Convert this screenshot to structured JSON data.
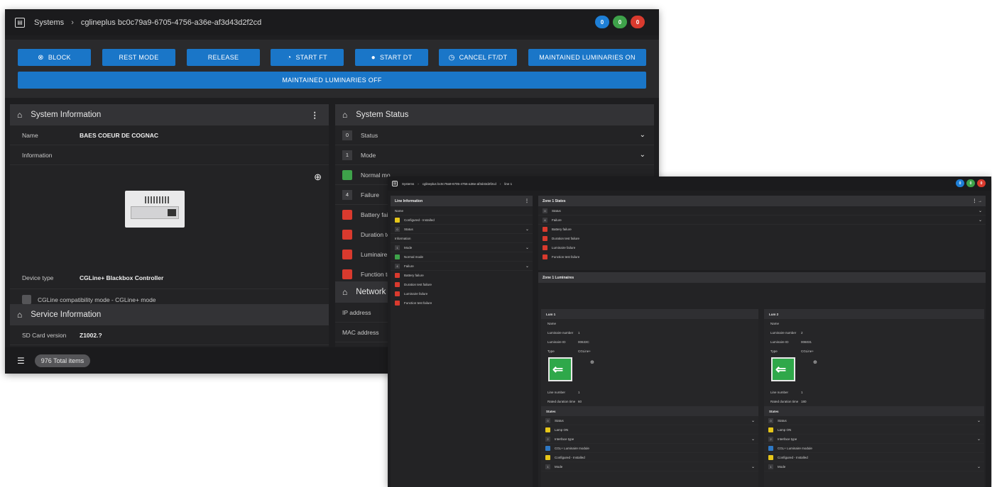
{
  "screen1": {
    "breadcrumb": {
      "root": "Systems",
      "current": "cglineplus bc0c79a9-6705-4756-a36e-af3d43d2f2cd"
    },
    "badges": [
      "0",
      "0",
      "0"
    ],
    "actions": {
      "block": "BLOCK",
      "rest_mode": "REST MODE",
      "release": "RELEASE",
      "start_ft": "START FT",
      "start_dt": "START DT",
      "cancel": "CANCEL FT/DT",
      "maint_on": "MAINTAINED LUMINARIES ON",
      "maint_off": "MAINTAINED LUMINARIES OFF"
    },
    "system_info": {
      "title": "System Information",
      "name_label": "Name",
      "name_value": "BAES COEUR DE COGNAC",
      "info_label": "Information",
      "device_label": "Device type",
      "device_value": "CGLine+ Blackbox Controller",
      "compat": "CGLine compatibility mode - CGLine+ mode"
    },
    "service_info": {
      "title": "Service Information",
      "sd_label": "SD Card version",
      "sd_value": "Z1002.?"
    },
    "system_status": {
      "title": "System Status",
      "rows": [
        {
          "num": "0",
          "label": "Status"
        },
        {
          "num": "1",
          "label": "Mode"
        },
        {
          "label": "Normal mo"
        },
        {
          "num": "4",
          "label": "Failure"
        },
        {
          "label": "Battery fai"
        },
        {
          "label": "Duration te"
        },
        {
          "label": "Luminaire"
        },
        {
          "label": "Function te"
        }
      ]
    },
    "network": {
      "title": "Network",
      "ip_label": "IP address",
      "mac_label": "MAC address"
    },
    "footer": {
      "total": "976 Total items"
    }
  },
  "screen2": {
    "breadcrumb": {
      "root": "Systems",
      "mid": "cglineplus bc0c79a9-6705-4756-a36e-af3d43d2f2cd",
      "current": "line 1"
    },
    "badges": [
      "0",
      "0",
      "0"
    ],
    "line_info": {
      "title": "Line Information",
      "name_label": "Name",
      "configured": "Configured - Installed",
      "status_num": "0",
      "status": "Status",
      "information": "Information",
      "mode_num": "1",
      "mode": "Mode",
      "normal": "Normal mode",
      "failure_num": "4",
      "failure": "Failure",
      "fails": [
        "Battery failure",
        "Duration test failure",
        "Luminaire failure",
        "Function test failure"
      ]
    },
    "zone_states": {
      "title": "Zone 1 States",
      "status_num": "0",
      "status": "Status",
      "failure_num": "4",
      "failure": "Failure",
      "fails": [
        "Battery failure",
        "Duration test failure",
        "Luminaire failure",
        "Function test failure"
      ]
    },
    "zone_lums": {
      "title": "Zone 1 Luminaires",
      "cards": [
        {
          "title": "Lum 1",
          "name_label": "Name",
          "num_label": "Luminaire number",
          "num": "1",
          "id_label": "Luminaire ID",
          "id": "00633C",
          "type_label": "Type",
          "type": "CGLine+",
          "line_label": "Line number",
          "line": "1",
          "dur_label": "Rated duration time",
          "dur": "60",
          "states": "States",
          "status_num": "0",
          "status": "Status",
          "lamp": "Lamp ON",
          "iface_num": "2",
          "iface": "Interface type",
          "module": "CGL+ Luminaire module",
          "configured": "Configured - Installed",
          "mode_num": "1",
          "mode": "Mode"
        },
        {
          "title": "Lum 2",
          "name_label": "Name",
          "num_label": "Luminaire number",
          "num": "2",
          "id_label": "Luminaire ID",
          "id": "006031",
          "type_label": "Type",
          "type": "CGLine+",
          "line_label": "Line number",
          "line": "1",
          "dur_label": "Rated duration time",
          "dur": "180",
          "states": "States",
          "status_num": "0",
          "status": "Status",
          "lamp": "Lamp ON",
          "iface_num": "2",
          "iface": "Interface type",
          "module": "CGL+ Luminaire module",
          "configured": "Configured - Installed",
          "mode_num": "1",
          "mode": "Mode"
        }
      ]
    }
  },
  "colors": {
    "primary": "#1a76c8",
    "success": "#3ea24a",
    "danger": "#d93a2e",
    "warning": "#e6c619",
    "bg": "#1e1e20"
  }
}
